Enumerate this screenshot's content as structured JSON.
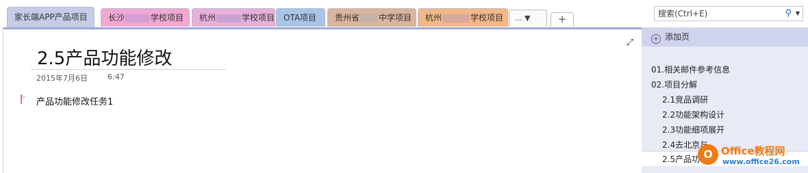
{
  "tabs": [
    {
      "label": "家长端APP产品项目",
      "bg": "#c6cbe8",
      "active": true
    },
    {
      "prefix": "长沙",
      "suffix": "学校项目",
      "bg": "#f0a8d4"
    },
    {
      "prefix": "杭州",
      "suffix": "学校项目",
      "bg": "#e8b0dc"
    },
    {
      "label": "OTA项目",
      "bg": "#a9c4ea"
    },
    {
      "prefix": "贵州省",
      "suffix": "中学项目",
      "bg": "#d9b59e"
    },
    {
      "prefix": "杭州",
      "suffix": "学校项目",
      "bg": "#f2b887"
    }
  ],
  "tab_more_label": "... ▼",
  "tab_add_label": "+",
  "search": {
    "text": "搜索(Ctrl+E)"
  },
  "page": {
    "title": "2.5产品功能修改",
    "date": "2015年7月6日",
    "time": "6:47",
    "task": "产品功能修改任务1"
  },
  "panel": {
    "add_page_label": "添加页",
    "pages": [
      "01.相关邮件参考信息",
      "02.项目分解",
      "2.1竞品调研",
      "2.2功能架构设计",
      "2.3功能细项展开",
      "2.4去北京与",
      "2.5产品功"
    ]
  },
  "watermark": {
    "brand": "Office教程网",
    "url": "www.office26.com"
  }
}
